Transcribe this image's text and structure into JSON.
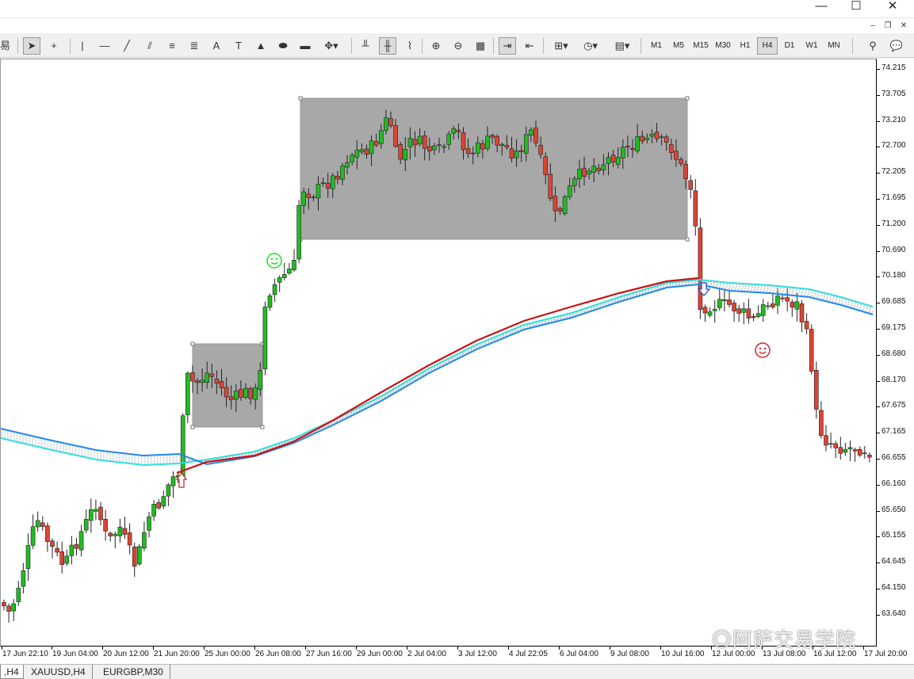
{
  "window": {
    "close_glyph": "✕",
    "maximize_glyph": "☐",
    "minimize_glyph": "—"
  },
  "toolbar": {
    "left_partial_glyph": "易",
    "timeframes": [
      "M1",
      "M5",
      "M15",
      "M30",
      "H1",
      "H4",
      "D1",
      "W1",
      "MN"
    ],
    "active_timeframe": "H4"
  },
  "chart": {
    "symbol_timeframe": "H4",
    "price_labels": [
      "74.215",
      "73.705",
      "73.210",
      "72.700",
      "72.205",
      "71.695",
      "71.200",
      "70.690",
      "70.180",
      "69.685",
      "69.175",
      "68.680",
      "68.170",
      "67.675",
      "67.165",
      "66.655",
      "66.160",
      "65.650",
      "65.155",
      "64.645",
      "64.150",
      "63.640"
    ],
    "time_labels": [
      "17 Jun 22:10",
      "19 Jun 04:00",
      "20 Jun 12:00",
      "21 Jun 20:00",
      "25 Jun 00:00",
      "26 Jun 08:00",
      "27 Jun 16:00",
      "29 Jun 00:00",
      "2 Jul 04:00",
      "3 Jul 12:00",
      "4 Jul 22:05",
      "6 Jul 04:00",
      "9 Jul 08:00",
      "10 Jul 16:00",
      "12 Jul 00:00",
      "13 Jul 08:00",
      "16 Jul 12:00",
      "17 Jul 20:00"
    ],
    "bull_color": "#22bb22",
    "bear_color": "#dd4433",
    "ma_colors": {
      "red": "#cc1111",
      "blue": "#2288ee",
      "cyan": "#33dddd"
    },
    "rect_color": "#a8a8a8",
    "smiley_buy_color": "#22dd22",
    "smiley_sell_color": "#dd2222"
  },
  "tabs": [
    {
      "label": ",H4",
      "active": true
    },
    {
      "label": "XAUUSD,H4",
      "active": false
    },
    {
      "label": "EURGBP,M30",
      "active": false
    }
  ],
  "watermark": "◎阿萨交易学院"
}
